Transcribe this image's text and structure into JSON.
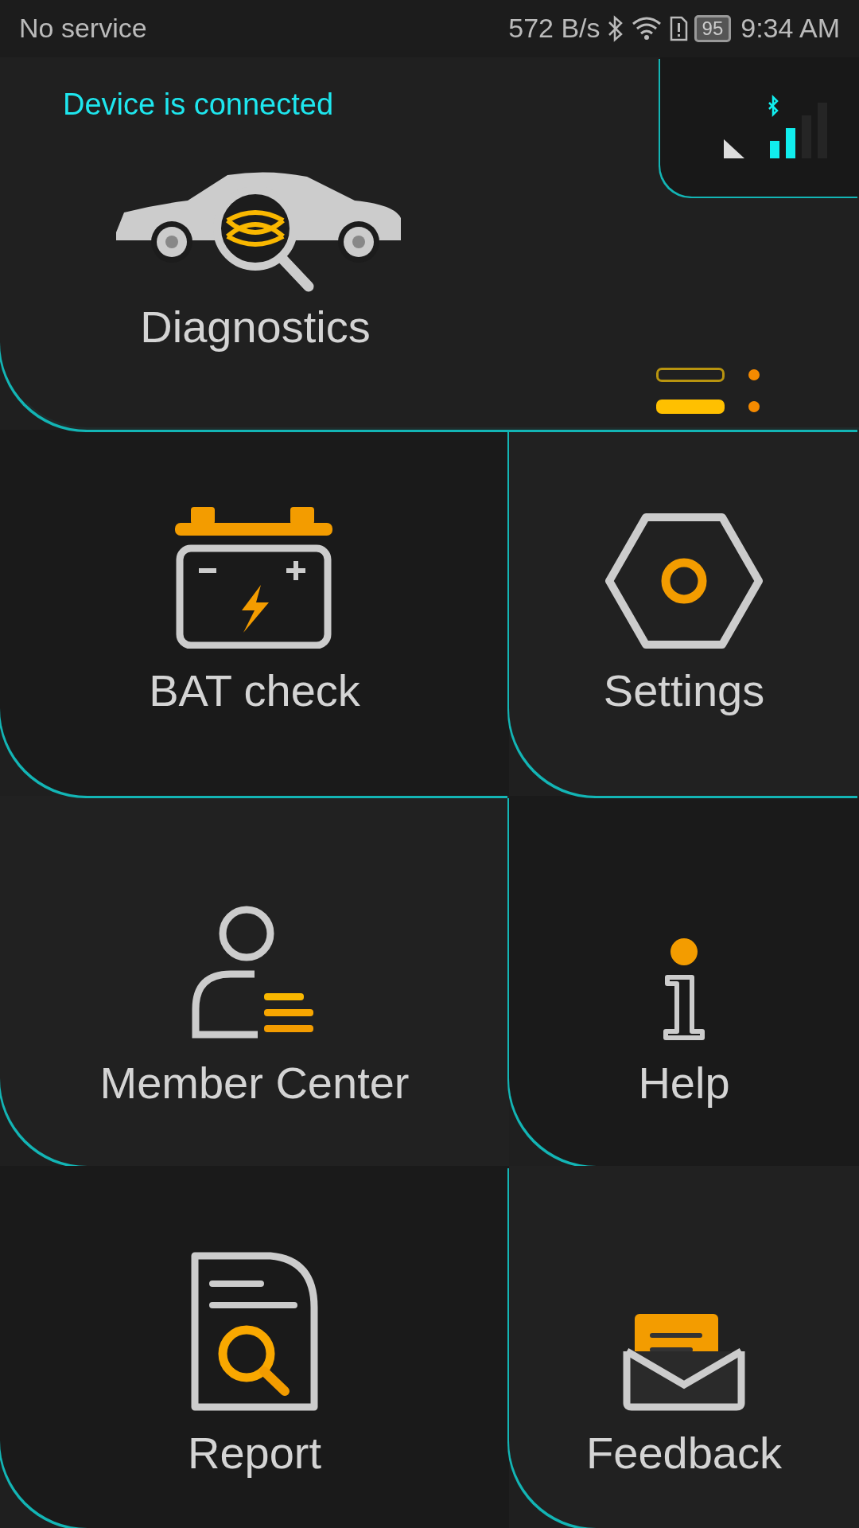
{
  "status_bar": {
    "carrier": "No service",
    "speed": "572 B/s",
    "battery": "95",
    "time": "9:34 AM"
  },
  "connection": {
    "text": "Device is connected"
  },
  "header": {
    "label": "Diagnostics",
    "pager": [
      {
        "selected": false
      },
      {
        "selected": true
      }
    ]
  },
  "tiles": [
    {
      "kind": "battery",
      "label": "BAT check"
    },
    {
      "kind": "settings",
      "label": "Settings"
    },
    {
      "kind": "member",
      "label": "Member Center"
    },
    {
      "kind": "help",
      "label": "Help"
    },
    {
      "kind": "report",
      "label": "Report"
    },
    {
      "kind": "feedback",
      "label": "Feedback"
    }
  ]
}
